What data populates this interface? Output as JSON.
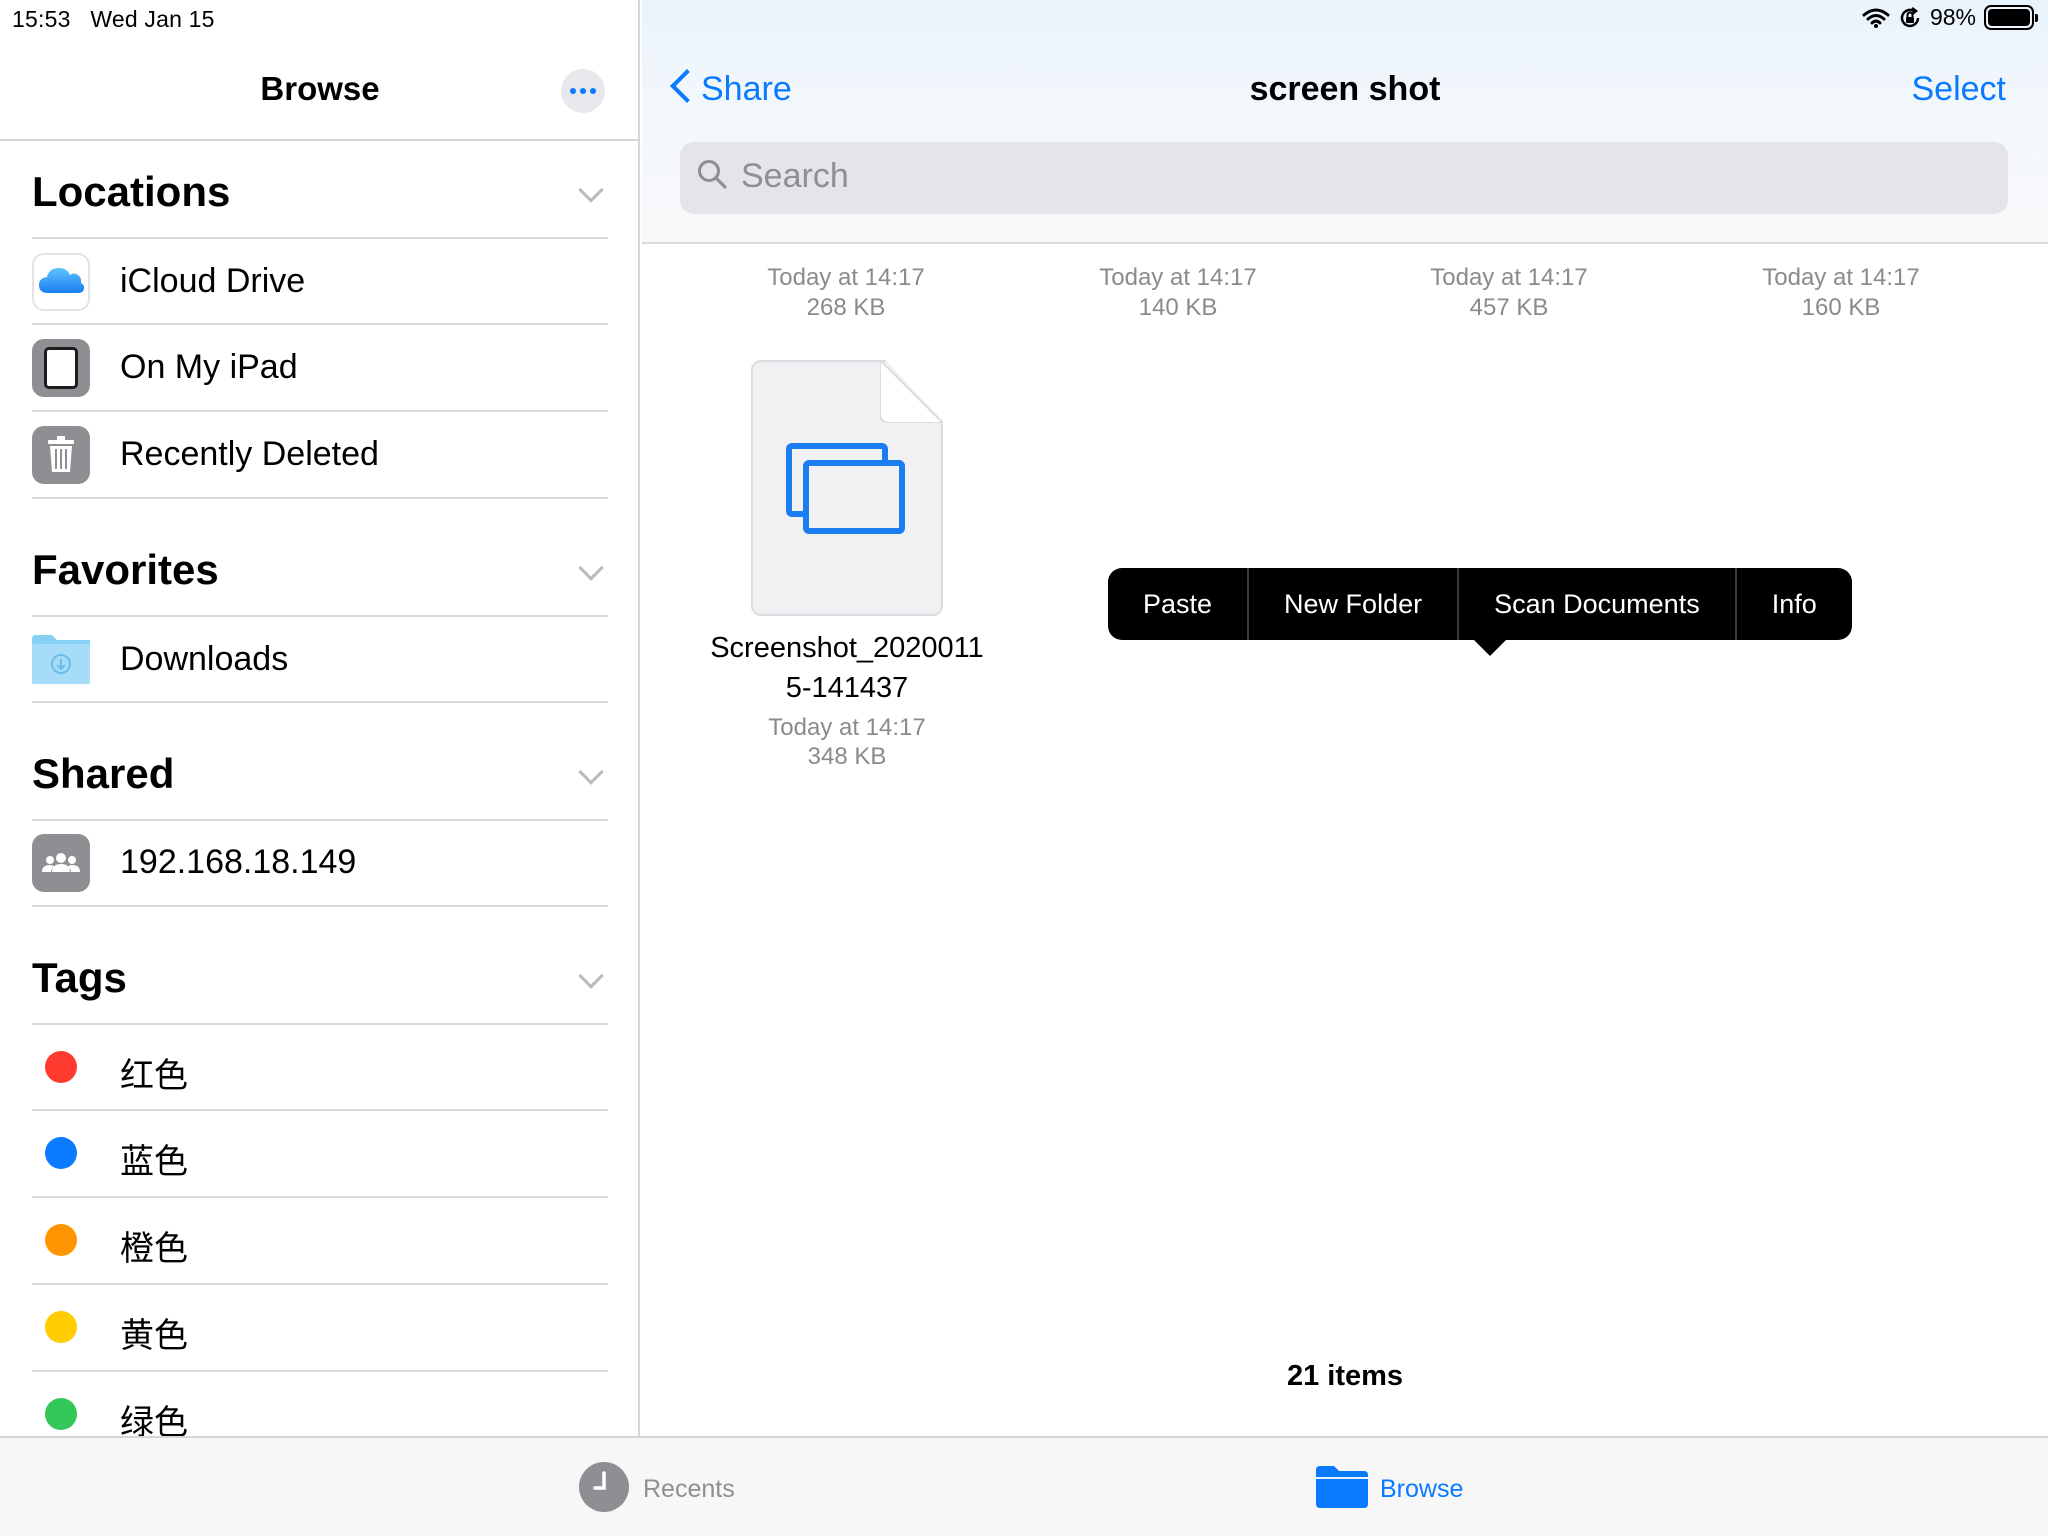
{
  "status_bar": {
    "time": "15:53",
    "date": "Wed Jan 15",
    "battery": "98%",
    "icons": [
      "wifi-icon",
      "orientation-lock-icon",
      "battery-icon"
    ]
  },
  "sidebar": {
    "title": "Browse",
    "more_icon": "ellipsis-icon",
    "locations": {
      "title": "Locations",
      "items": [
        {
          "label": "iCloud Drive",
          "icon": "icloud-icon"
        },
        {
          "label": "On My iPad",
          "icon": "ipad-icon"
        },
        {
          "label": "Recently Deleted",
          "icon": "trash-icon"
        }
      ]
    },
    "favorites": {
      "title": "Favorites",
      "items": [
        {
          "label": "Downloads",
          "icon": "downloads-folder-icon"
        }
      ]
    },
    "shared": {
      "title": "Shared",
      "items": [
        {
          "label": "192.168.18.149",
          "icon": "server-icon"
        }
      ]
    },
    "tags": {
      "title": "Tags",
      "items": [
        {
          "label": "红色",
          "color": "#ff3b30"
        },
        {
          "label": "蓝色",
          "color": "#0a7aff"
        },
        {
          "label": "橙色",
          "color": "#ff9500"
        },
        {
          "label": "黄色",
          "color": "#ffcc00"
        },
        {
          "label": "绿色",
          "color": "#34c759"
        }
      ]
    }
  },
  "nav": {
    "back_label": "Share",
    "title": "screen shot",
    "select_label": "Select",
    "search_placeholder": "Search"
  },
  "files_top_row": [
    {
      "date": "Today at 14:17",
      "size": "268 KB"
    },
    {
      "date": "Today at 14:17",
      "size": "140 KB"
    },
    {
      "date": "Today at 14:17",
      "size": "457 KB"
    },
    {
      "date": "Today at 14:17",
      "size": "160 KB"
    }
  ],
  "file": {
    "name_line1": "Screenshot_2020011",
    "name_line2": "5-141437",
    "date": "Today at 14:17",
    "size": "348 KB"
  },
  "context_menu": {
    "paste": "Paste",
    "new_folder": "New Folder",
    "scan_documents": "Scan Documents",
    "info": "Info"
  },
  "footer": {
    "items_count": "21 items"
  },
  "tabbar": {
    "recents": "Recents",
    "browse": "Browse"
  },
  "colors": {
    "accent": "#0a7aff",
    "secondary_text": "#8a8a8f",
    "separator": "#d9d9dd"
  }
}
